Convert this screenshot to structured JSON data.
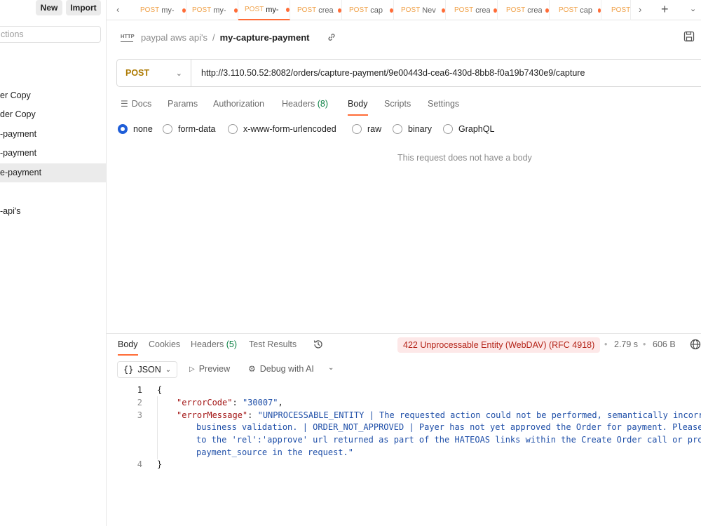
{
  "sidebar": {
    "new_label": "New",
    "import_label": "Import",
    "search_placeholder": "ctions",
    "items": [
      {
        "label": "er Copy"
      },
      {
        "label": "der Copy"
      },
      {
        "label": "-payment"
      },
      {
        "label": "-payment"
      },
      {
        "label": "e-payment"
      },
      {
        "label": "-api's"
      }
    ]
  },
  "tabs": [
    {
      "method": "POST",
      "name": "my-"
    },
    {
      "method": "POST",
      "name": "my-"
    },
    {
      "method": "POST",
      "name": "my-"
    },
    {
      "method": "POST",
      "name": "crea"
    },
    {
      "method": "POST",
      "name": "cap"
    },
    {
      "method": "POST",
      "name": "Nev"
    },
    {
      "method": "POST",
      "name": "crea"
    },
    {
      "method": "POST",
      "name": "crea"
    },
    {
      "method": "POST",
      "name": "cap"
    },
    {
      "method": "POST",
      "name": ""
    }
  ],
  "breadcrumb": {
    "collection": "paypal aws api's",
    "separator": "/",
    "request": "my-capture-payment"
  },
  "request": {
    "method": "POST",
    "url": "http://3.110.50.52:8082/orders/capture-payment/9e00443d-cea6-430d-8bb8-f0a19b7430e9/capture",
    "tabs": {
      "docs": "Docs",
      "params": "Params",
      "authorization": "Authorization",
      "headers": "Headers",
      "headers_count": "(8)",
      "body": "Body",
      "scripts": "Scripts",
      "settings": "Settings"
    },
    "body_types": [
      "none",
      "form-data",
      "x-www-form-urlencoded",
      "raw",
      "binary",
      "GraphQL"
    ],
    "selected_body_type": "none",
    "empty_body_text": "This request does not have a body"
  },
  "response": {
    "tabs": {
      "body": "Body",
      "cookies": "Cookies",
      "headers": "Headers",
      "headers_count": "(5)",
      "test_results": "Test Results"
    },
    "status": "422 Unprocessable Entity (WebDAV) (RFC 4918)",
    "time": "2.79 s",
    "size": "606 B",
    "format": "JSON",
    "preview_label": "Preview",
    "debug_label": "Debug with AI",
    "lines": {
      "l1": "{",
      "l2_key": "\"errorCode\"",
      "l2_val": "\"30007\"",
      "l3_key": "\"errorMessage\"",
      "l3_val_a": "\"UNPROCESSABLE_ENTITY | The requested action could not be performed, semantically incorrect",
      "l3_val_b": "business validation. | ORDER_NOT_APPROVED | Payer has not yet approved the Order for payment. Please r",
      "l3_val_c": "to the 'rel':'approve' url returned as part of the HATEOAS links within the Create Order call or provi",
      "l3_val_d": "payment_source in the request.\"",
      "l4": "}"
    },
    "line_numbers": [
      "1",
      "2",
      "3",
      "4"
    ]
  }
}
